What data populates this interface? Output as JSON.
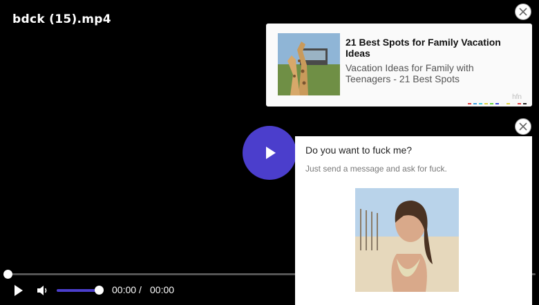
{
  "player": {
    "title": "bdck (15).mp4",
    "time_current": "00:00",
    "time_separator": "/",
    "time_total": "00:00",
    "progress": 0,
    "volume": 1,
    "accent_color": "#4b3ecc"
  },
  "ad_card": {
    "headline": "21 Best Spots for Family Vacation Ideas",
    "description": "Vacation Ideas for Family with Teenagers - 21 Best Spots",
    "brand": "hfn",
    "dot_colors": [
      "#e03c3c",
      "#3c9de0",
      "#3cc9e0",
      "#e0d23c",
      "#6ad63c",
      "#3c4be0",
      "#f5f5f5",
      "#e0d23c",
      "#f5f5f5",
      "#e03c3c",
      "#222222"
    ]
  },
  "message_card": {
    "title": "Do you want to fuck me?",
    "subtitle": "Just send a message and ask for fuck."
  },
  "icons": {
    "close": "close-icon",
    "play": "play-icon",
    "volume": "volume-icon"
  }
}
